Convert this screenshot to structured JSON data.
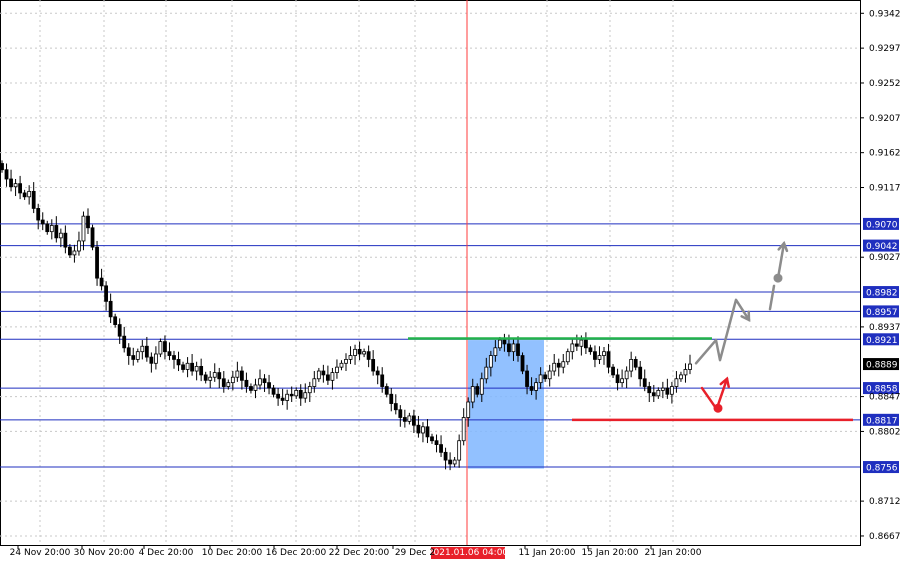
{
  "chart_data": {
    "type": "candlestick",
    "title": "",
    "y_range": [
      0.8645,
      0.9354
    ],
    "y_ticks": [
      "0.9342",
      "0.9297",
      "0.9252",
      "0.9207",
      "0.9162",
      "0.9117",
      "0.9027",
      "0.8937",
      "0.8847",
      "0.8802",
      "0.8712",
      "0.8667"
    ],
    "x_ticks": [
      "24 Nov 20:00",
      "30 Nov 20:00",
      "4 Dec 20:00",
      "10 Dec 20:00",
      "16 Dec 20:00",
      "22 Dec 20:00",
      "29 Dec 2",
      "11 Jan 20:00",
      "15 Jan 20:00",
      "21 Jan 20:00"
    ],
    "vertical_marker": {
      "label": "2021.01.06 04:00",
      "color": "#ff3b3b"
    },
    "current_price": "0.8889",
    "levels": [
      {
        "value": "0.9070",
        "color": "#1f2fbf"
      },
      {
        "value": "0.9042",
        "color": "#1f2fbf"
      },
      {
        "value": "0.8982",
        "color": "#1f2fbf"
      },
      {
        "value": "0.8957",
        "color": "#1f2fbf"
      },
      {
        "value": "0.8921",
        "color": "#1f2fbf"
      },
      {
        "value": "0.8858",
        "color": "#1f2fbf"
      },
      {
        "value": "0.8817",
        "color": "#1f2fbf"
      },
      {
        "value": "0.8756",
        "color": "#1f2fbf"
      }
    ],
    "series_close": [
      0.914,
      0.9128,
      0.9118,
      0.9122,
      0.911,
      0.9105,
      0.9112,
      0.909,
      0.9075,
      0.907,
      0.906,
      0.9068,
      0.9052,
      0.9058,
      0.904,
      0.903,
      0.9035,
      0.9048,
      0.908,
      0.9065,
      0.904,
      0.9,
      0.899,
      0.897,
      0.895,
      0.894,
      0.8925,
      0.891,
      0.89,
      0.8895,
      0.8905,
      0.8912,
      0.8898,
      0.889,
      0.8902,
      0.8918,
      0.8905,
      0.89,
      0.8895,
      0.8888,
      0.8882,
      0.889,
      0.888,
      0.8886,
      0.8875,
      0.8868,
      0.8872,
      0.8878,
      0.887,
      0.886,
      0.8865,
      0.8872,
      0.888,
      0.8868,
      0.886,
      0.8855,
      0.8862,
      0.887,
      0.8865,
      0.8858,
      0.885,
      0.8845,
      0.8842,
      0.885,
      0.8848,
      0.8855,
      0.8845,
      0.8852,
      0.886,
      0.887,
      0.888,
      0.8875,
      0.8868,
      0.8878,
      0.8885,
      0.889,
      0.8895,
      0.89,
      0.8908,
      0.8902,
      0.8905,
      0.8895,
      0.888,
      0.8875,
      0.886,
      0.885,
      0.8838,
      0.883,
      0.882,
      0.8815,
      0.8822,
      0.881,
      0.88,
      0.8808,
      0.8795,
      0.879,
      0.8785,
      0.8775,
      0.8765,
      0.876,
      0.8765,
      0.879,
      0.882,
      0.884,
      0.886,
      0.885,
      0.887,
      0.8885,
      0.89,
      0.891,
      0.892,
      0.8915,
      0.8905,
      0.8915,
      0.89,
      0.888,
      0.886,
      0.8855,
      0.8865,
      0.8875,
      0.887,
      0.888,
      0.889,
      0.8885,
      0.8892,
      0.8905,
      0.8915,
      0.8912,
      0.892,
      0.891,
      0.8905,
      0.8895,
      0.89,
      0.8905,
      0.8885,
      0.8875,
      0.8865,
      0.887,
      0.888,
      0.8895,
      0.8885,
      0.887,
      0.886,
      0.8852,
      0.8848,
      0.8855,
      0.8858,
      0.885,
      0.886,
      0.887,
      0.8875,
      0.8882,
      0.8889
    ],
    "green_level": 0.8922,
    "red_level": 0.8817,
    "highlight_zone": {
      "y_top": 0.892,
      "y_bottom": 0.8754
    },
    "forecast_paths": [
      {
        "color": "#8c8c8c",
        "points": [
          [
            0.889,
            0
          ],
          [
            0.892,
            1
          ],
          [
            0.8892,
            2
          ],
          [
            0.897,
            3
          ],
          [
            0.8945,
            4
          ]
        ]
      },
      {
        "color": "#8c8c8c",
        "points": [
          [
            0.896,
            5
          ],
          [
            0.899,
            6
          ]
        ]
      },
      {
        "color": "#8c8c8c",
        "points": [
          [
            0.9,
            7
          ],
          [
            0.9045,
            8
          ]
        ]
      },
      {
        "color": "#e8202a",
        "points": [
          [
            0.8855,
            9
          ],
          [
            0.883,
            10
          ]
        ]
      },
      {
        "color": "#e8202a",
        "points": [
          [
            0.8835,
            11
          ],
          [
            0.887,
            12
          ]
        ]
      }
    ]
  }
}
